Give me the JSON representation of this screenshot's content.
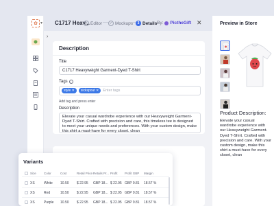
{
  "header": {
    "product_title": "C1717 Heav...",
    "steps": [
      {
        "label": "Editor"
      },
      {
        "label": "Mockups"
      },
      {
        "label": "Details",
        "number": "3"
      }
    ],
    "by_label": "By:",
    "brand": "PicthеGift"
  },
  "description_section": {
    "title": "Description",
    "title_label": "Title",
    "title_value": "C1717 Heavyweight Garment-Dyed T-Shirt",
    "tags_label": "Tags",
    "tags": [
      "style",
      "sickspout"
    ],
    "tag_placeholder": "Enter tags",
    "tag_hint": "Add tag and press enter",
    "desc_label": "Description",
    "desc_value": "Elevate your casual wardrobe experience with our Heavyweight Garment-Dyed T-Shirt. Crafted with precision and care, this timeless tee is designed to meet your unique needs and preferences. With your custom design, make this shirt a must-have for every closet. clean"
  },
  "preview": {
    "title": "Preview in Store",
    "product_desc_title": "Product Description:",
    "product_desc_text": "Elevate your casual wardrobe experience with our Heavyweight Garment-Dyed T-Shirt. Crafted with precision and care. With your custom design, make this shirt a must-have for every closet, clean"
  },
  "variants": {
    "title": "Variants",
    "columns": [
      "Size",
      "Color",
      "Cost",
      "Retail Price",
      "Retails Pr...",
      "Profit",
      "Profit GBP",
      "Margin"
    ],
    "rows": [
      {
        "size": "XS",
        "color": "White",
        "cost": "10.50",
        "retail": "$ 22.95",
        "retail2": "GBP 18...",
        "profit": "$ 22.95",
        "profit_gbp": "GBP 9.81",
        "margin": "18.57 %"
      },
      {
        "size": "XS",
        "color": "Red",
        "cost": "10.50",
        "retail": "$ 22.95",
        "retail2": "GBP 18...",
        "profit": "$ 22.95",
        "profit_gbp": "GBP 9.81",
        "margin": "18.57 %"
      },
      {
        "size": "XS",
        "color": "Purple",
        "cost": "10.50",
        "retail": "$ 22.95",
        "retail2": "GBP 18...",
        "profit": "$ 22.95",
        "profit_gbp": "GBP 9.81",
        "margin": "18.57 %"
      }
    ]
  },
  "colors": {
    "accent": "#3b6be8",
    "tag_chip": "#3b78e7",
    "brand_logo": "#e07d55"
  }
}
